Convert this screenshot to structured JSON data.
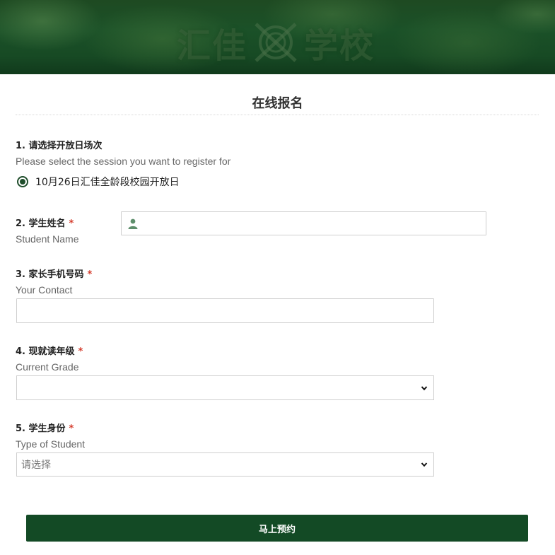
{
  "banner": {
    "title_left": "汇佳",
    "title_right": "学校",
    "bg_color": "#1b5128"
  },
  "form": {
    "title": "在线报名",
    "questions": [
      {
        "label": "1. 请选择开放日场次",
        "sub": "Please select the session you want to register for",
        "required": false,
        "options": [
          {
            "label": "10月26日汇佳全龄段校园开放日",
            "selected": true
          }
        ]
      },
      {
        "label": "2. 学生姓名",
        "sub": "Student Name",
        "required": true,
        "value": "",
        "icon": "user-icon"
      },
      {
        "label": "3. 家长手机号码",
        "sub": "Your Contact",
        "required": true,
        "value": ""
      },
      {
        "label": "4. 现就读年级",
        "sub": "Current Grade",
        "required": true,
        "selected": ""
      },
      {
        "label": "5. 学生身份",
        "sub": "Type of Student",
        "required": true,
        "selected": "请选择"
      }
    ],
    "required_mark": "*",
    "submit_label": "马上预约"
  },
  "colors": {
    "accent": "#134a25",
    "required": "#d43a2a"
  }
}
